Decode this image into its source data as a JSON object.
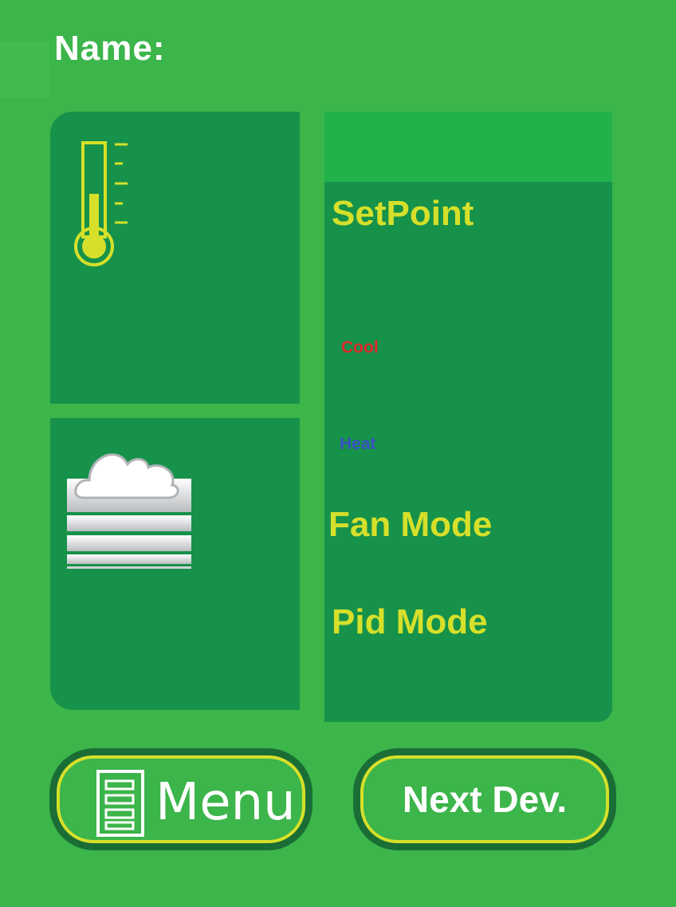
{
  "header": {
    "name_label": "Name:"
  },
  "status": {
    "setpoint_label": "SetPoint",
    "cool_label": "Cool",
    "heat_label": "Heat",
    "fan_mode_label": "Fan Mode",
    "pid_mode_label": "Pid Mode"
  },
  "icons": {
    "temperature": "thermometer-icon",
    "weather": "cloud-fog-icon",
    "menu": "menu-list-icon"
  },
  "buttons": {
    "menu_label": "Menu",
    "next_device_label": "Next Dev."
  },
  "colors": {
    "background": "#3cb54a",
    "panel": "#16924a",
    "accent_yellow": "#d6e02a",
    "cool": "#e0262b",
    "heat": "#3a4fc4",
    "button_border": "#1a6e35"
  }
}
